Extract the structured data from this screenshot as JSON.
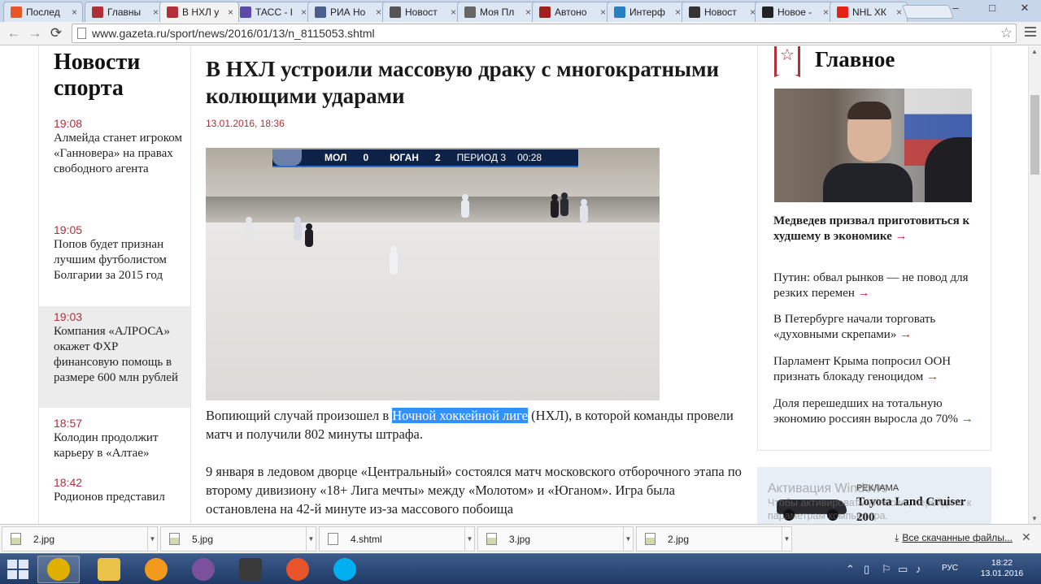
{
  "browser": {
    "tabs": [
      {
        "label": "Послед",
        "color": "#e8552a",
        "icon": "firefox-like-icon"
      },
      {
        "label": "Главны",
        "color": "#b12f39",
        "icon": "gazeta-icon"
      },
      {
        "label": "В НХЛ у",
        "color": "#b12f39",
        "icon": "gazeta-icon",
        "active": true
      },
      {
        "label": "ТАСС - I",
        "color": "#5b4aa8",
        "icon": "tass-icon"
      },
      {
        "label": "РИА Но",
        "color": "#4a5d8c",
        "icon": "ria-icon"
      },
      {
        "label": "Новост",
        "color": "#555555",
        "icon": "news-icon"
      },
      {
        "label": "Моя Пл",
        "color": "#666666",
        "icon": "location-icon"
      },
      {
        "label": "Автоно",
        "color": "#a02020",
        "icon": "auto-icon"
      },
      {
        "label": "Интерф",
        "color": "#2a7fc1",
        "icon": "interfax-icon"
      },
      {
        "label": "Новост",
        "color": "#333333",
        "icon": "l-icon"
      },
      {
        "label": "Новое -",
        "color": "#222222",
        "icon": "circle-icon"
      },
      {
        "label": "NHL ХК",
        "color": "#e62117",
        "icon": "youtube-icon"
      }
    ],
    "url": "www.gazeta.ru/sport/news/2016/01/13/n_8115053.shtml",
    "window_controls": {
      "minimize": "–",
      "maximize": "□",
      "close": "✕"
    }
  },
  "sidebar": {
    "title": "Новости спорта",
    "items": [
      {
        "time": "19:08",
        "title": "Алмейда станет игроком «Ганновера» на правах свободного агента"
      },
      {
        "time": "19:05",
        "title": "Попов будет признан лучшим футболистом Болгарии за 2015 год"
      },
      {
        "time": "19:03",
        "title": "Компания «АЛРОСА» окажет ФХР финансовую помощь в размере 600 млн рублей",
        "highlighted": true
      },
      {
        "time": "18:57",
        "title": "Колодин продолжит карьеру в «Алтае»"
      },
      {
        "time": "18:42",
        "title": "Родионов представил"
      }
    ]
  },
  "article": {
    "title": "В НХЛ устроили массовую драку с многократными колющими ударами",
    "date": "13.01.2016, 18:36",
    "video": {
      "scoreboard": {
        "team1": "МОЛ",
        "score1": "0",
        "team2": "ЮГАН",
        "score2": "2",
        "period": "ПЕРИОД 3",
        "clock": "00:28"
      }
    },
    "p1_before": "Вопиющий случай произошел в",
    "p1_selected": "Ночной хоккейной лиге",
    "p1_after": "(НХЛ), в которой команды провели матч и получили 802 минуты штрафа.",
    "p2": "9 января в ледовом дворце «Центральный» состоялся матч московского отборочного этапа по второму дивизиону «18+ Лига мечты» между «Молотом» и «Юганом». Игра была остановлена на 42-й минуте из-за массового побоища"
  },
  "main_news": {
    "heading": "Главное",
    "items": [
      {
        "text": "Медведев призвал приготовиться к худшему в экономике",
        "main": true
      },
      {
        "text": "Путин: обвал рынков — не повод для резких перемен"
      },
      {
        "text": "В Петербурге начали торговать «духовными скрепами»"
      },
      {
        "text": "Парламент Крыма попросил ООН признать блокаду геноцидом"
      },
      {
        "text": "Доля перешедших на тотальную экономию россиян выросла до 70%"
      }
    ],
    "arrow": "→"
  },
  "ad": {
    "label": "РЕКЛАМА",
    "title": "Toyota Land Cruiser 200"
  },
  "watermark": {
    "line1": "Активация Windows",
    "line2": "Чтобы активировать Windows, перейдите к параметрам компьютера."
  },
  "downloads": {
    "items": [
      {
        "name": "2.jpg",
        "type": "jpg"
      },
      {
        "name": "5.jpg",
        "type": "jpg"
      },
      {
        "name": "4.shtml",
        "type": "doc"
      },
      {
        "name": "3.jpg",
        "type": "jpg"
      },
      {
        "name": "2.jpg",
        "type": "jpg"
      }
    ],
    "all_label": "Все скачанные файлы...",
    "close": "✕"
  },
  "taskbar": {
    "apps": [
      {
        "name": "chrome-taskbar-icon",
        "color": "#e0b000",
        "active": true
      },
      {
        "name": "explorer-taskbar-icon",
        "color": "#e9c24a"
      },
      {
        "name": "ok-taskbar-icon",
        "color": "#f39a1e"
      },
      {
        "name": "viber-taskbar-icon",
        "color": "#7b519d"
      },
      {
        "name": "camera-taskbar-icon",
        "color": "#3a3a3a"
      },
      {
        "name": "firefox-taskbar-icon",
        "color": "#e8552a"
      },
      {
        "name": "skype-taskbar-icon",
        "color": "#00aff0"
      }
    ],
    "lang": "РУС",
    "time": "18:22",
    "date": "13.01.2016"
  }
}
